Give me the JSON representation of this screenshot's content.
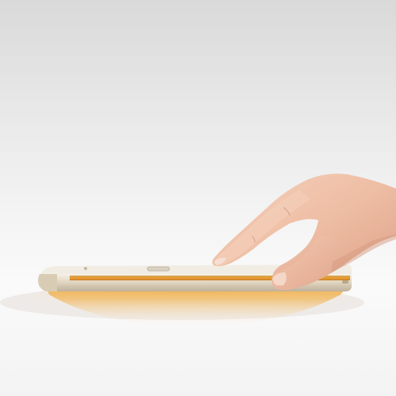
{
  "photo": {
    "subject": "hand-touching-phone-edge",
    "colors": {
      "background_top": "#d9d9d9",
      "background_bottom": "#f7f6f6",
      "phone_frame": "#e6dcc8",
      "phone_accent": "#e7a640",
      "phone_reflection": "#f0a11a",
      "skin": "#efc1a8",
      "skin_shadow": "#d99a82"
    }
  }
}
